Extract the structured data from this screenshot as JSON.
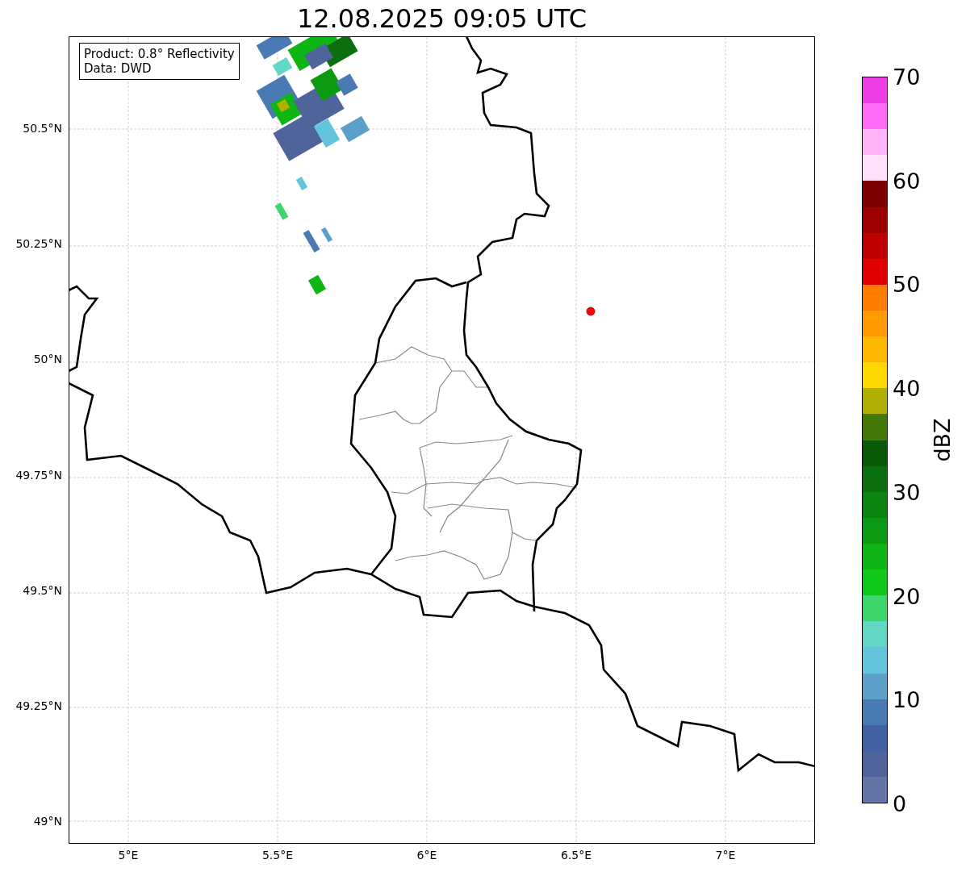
{
  "title": "12.08.2025 09:05 UTC",
  "info_box": {
    "lines": [
      "Product: 0.8° Reflectivity",
      "Data: DWD"
    ]
  },
  "map": {
    "yticks": [
      "50.5°N",
      "50.25°N",
      "50°N",
      "49.75°N",
      "49.5°N",
      "49.25°N",
      "49°N"
    ],
    "xticks": [
      "5°E",
      "5.5°E",
      "6°E",
      "6.5°E",
      "7°E"
    ]
  },
  "colorbar": {
    "label": "dBZ",
    "ticks": [
      "70",
      "60",
      "50",
      "40",
      "30",
      "20",
      "10",
      "0"
    ],
    "bands": [
      {
        "color": "#ee3ee8"
      },
      {
        "color": "#ff6cf8"
      },
      {
        "color": "#ffb3f8"
      },
      {
        "color": "#ffe0fc"
      },
      {
        "color": "#7a0000"
      },
      {
        "color": "#9e0000"
      },
      {
        "color": "#be0000"
      },
      {
        "color": "#e00000"
      },
      {
        "color": "#ff7c00"
      },
      {
        "color": "#ff9a00"
      },
      {
        "color": "#ffb800"
      },
      {
        "color": "#ffd800"
      },
      {
        "color": "#b0b000"
      },
      {
        "color": "#457a0a"
      },
      {
        "color": "#0a5a0a"
      },
      {
        "color": "#0a700f"
      },
      {
        "color": "#0c850f"
      },
      {
        "color": "#0c9a12"
      },
      {
        "color": "#0eb515"
      },
      {
        "color": "#10c818"
      },
      {
        "color": "#3cd66a"
      },
      {
        "color": "#60d8c4"
      },
      {
        "color": "#64c4dc"
      },
      {
        "color": "#5aa0c8"
      },
      {
        "color": "#4a7ab4"
      },
      {
        "color": "#4260a4"
      },
      {
        "color": "#50649c"
      },
      {
        "color": "#6474a4"
      }
    ]
  }
}
